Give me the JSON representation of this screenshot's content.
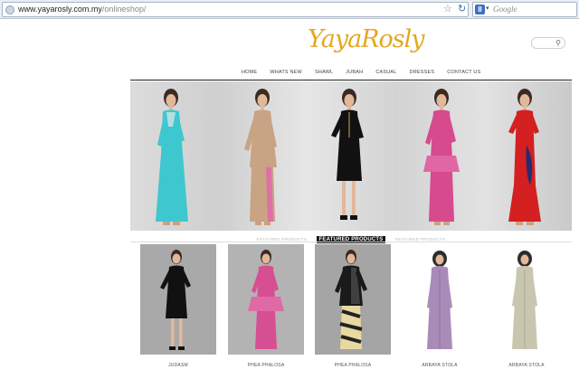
{
  "browser": {
    "url_domain": "www.yayarosly.com.my",
    "url_path": "/onlineshop/",
    "search_engine_badge": "8",
    "search_placeholder": "Google",
    "icons": [
      "globe-icon",
      "star-icon",
      "refresh-icon",
      "search-engine-icon"
    ]
  },
  "site": {
    "logo_text": "YayaRosly",
    "brand_color": "#e3a820",
    "nav": [
      "HOME",
      "WHATS NEW",
      "SHAWL",
      "JUBAH",
      "CASUAL",
      "DRESSES",
      "CONTACT US"
    ]
  },
  "hero": {
    "models": [
      {
        "dress_color": "#3fc7cf"
      },
      {
        "dress_color": "#c8a384"
      },
      {
        "dress_color": "#111111"
      },
      {
        "dress_color": "#d64a8e"
      },
      {
        "dress_color": "#d42020"
      }
    ]
  },
  "section_tabs": {
    "left": "FEATURED PRODUCTS",
    "active": "FEATURED PRODUCTS",
    "right": "FEATURED PRODUCTS"
  },
  "products": [
    {
      "name": "JUDASM",
      "dress_color": "#111111",
      "bg": "#a9a9a9"
    },
    {
      "name": "PHEA PHALOSA",
      "dress_color": "#d74f93",
      "bg": "#b3b3b3"
    },
    {
      "name": "PHEA PHALOSA",
      "dress_color": "#1a1a1a",
      "bg": "#a5a5a5"
    },
    {
      "name": "ARBAYA STOLA",
      "dress_color": "#a98bb8",
      "bg": "#ffffff"
    },
    {
      "name": "ARBAYA STOLA",
      "dress_color": "#c9c6b0",
      "bg": "#ffffff"
    }
  ]
}
